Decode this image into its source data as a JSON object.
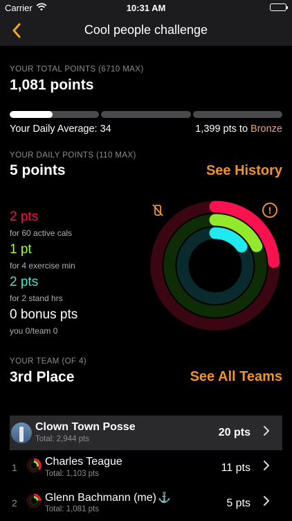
{
  "status_bar": {
    "carrier": "Carrier",
    "time": "10:31 AM"
  },
  "nav": {
    "title": "Cool people challenge",
    "back_icon": "chevron-left-icon"
  },
  "total_points": {
    "label": "YOUR TOTAL POINTS (6710 MAX)",
    "value": "1,081 points",
    "progress_fraction": 0.161,
    "daily_average": "Your Daily Average: 34",
    "to_next_prefix": "1,399 pts to ",
    "to_next_tier": "Bronze"
  },
  "daily_points": {
    "label": "YOUR DAILY POINTS (110 MAX)",
    "value": "5 points",
    "see_history": "See History"
  },
  "stats": [
    {
      "value": "2 pts",
      "sub": "for 60 active cals",
      "color": "#fa114f"
    },
    {
      "value": "1 pt",
      "sub": "for 4 exercise min",
      "color": "#a8ff2f"
    },
    {
      "value": "2 pts",
      "sub": "for 2 stand hrs",
      "color": "#4fe3d0"
    },
    {
      "value": "0 bonus pts",
      "sub": "you 0/team 0",
      "color": "#ffffff"
    }
  ],
  "rings": {
    "move_fraction": 0.24,
    "exercise_fraction": 0.18,
    "stand_fraction": 0.15,
    "colors": {
      "move": "#fa114f",
      "exercise": "#92e82a",
      "stand": "#1eeaef"
    }
  },
  "team": {
    "label": "YOUR TEAM (OF 4)",
    "place": "3rd Place",
    "see_all": "See All Teams",
    "name": "Clown Town Posse",
    "total": "Total: 2,944 pts",
    "pts": "20 pts",
    "members": [
      {
        "rank": "1",
        "name": "Charles Teague",
        "total": "Total: 1,103 pts",
        "pts": "11 pts"
      },
      {
        "rank": "2",
        "name": "Glenn Bachmann (me)",
        "total": "Total: 1,081 pts",
        "pts": "5 pts"
      }
    ]
  },
  "accent_color": "#f0932b"
}
